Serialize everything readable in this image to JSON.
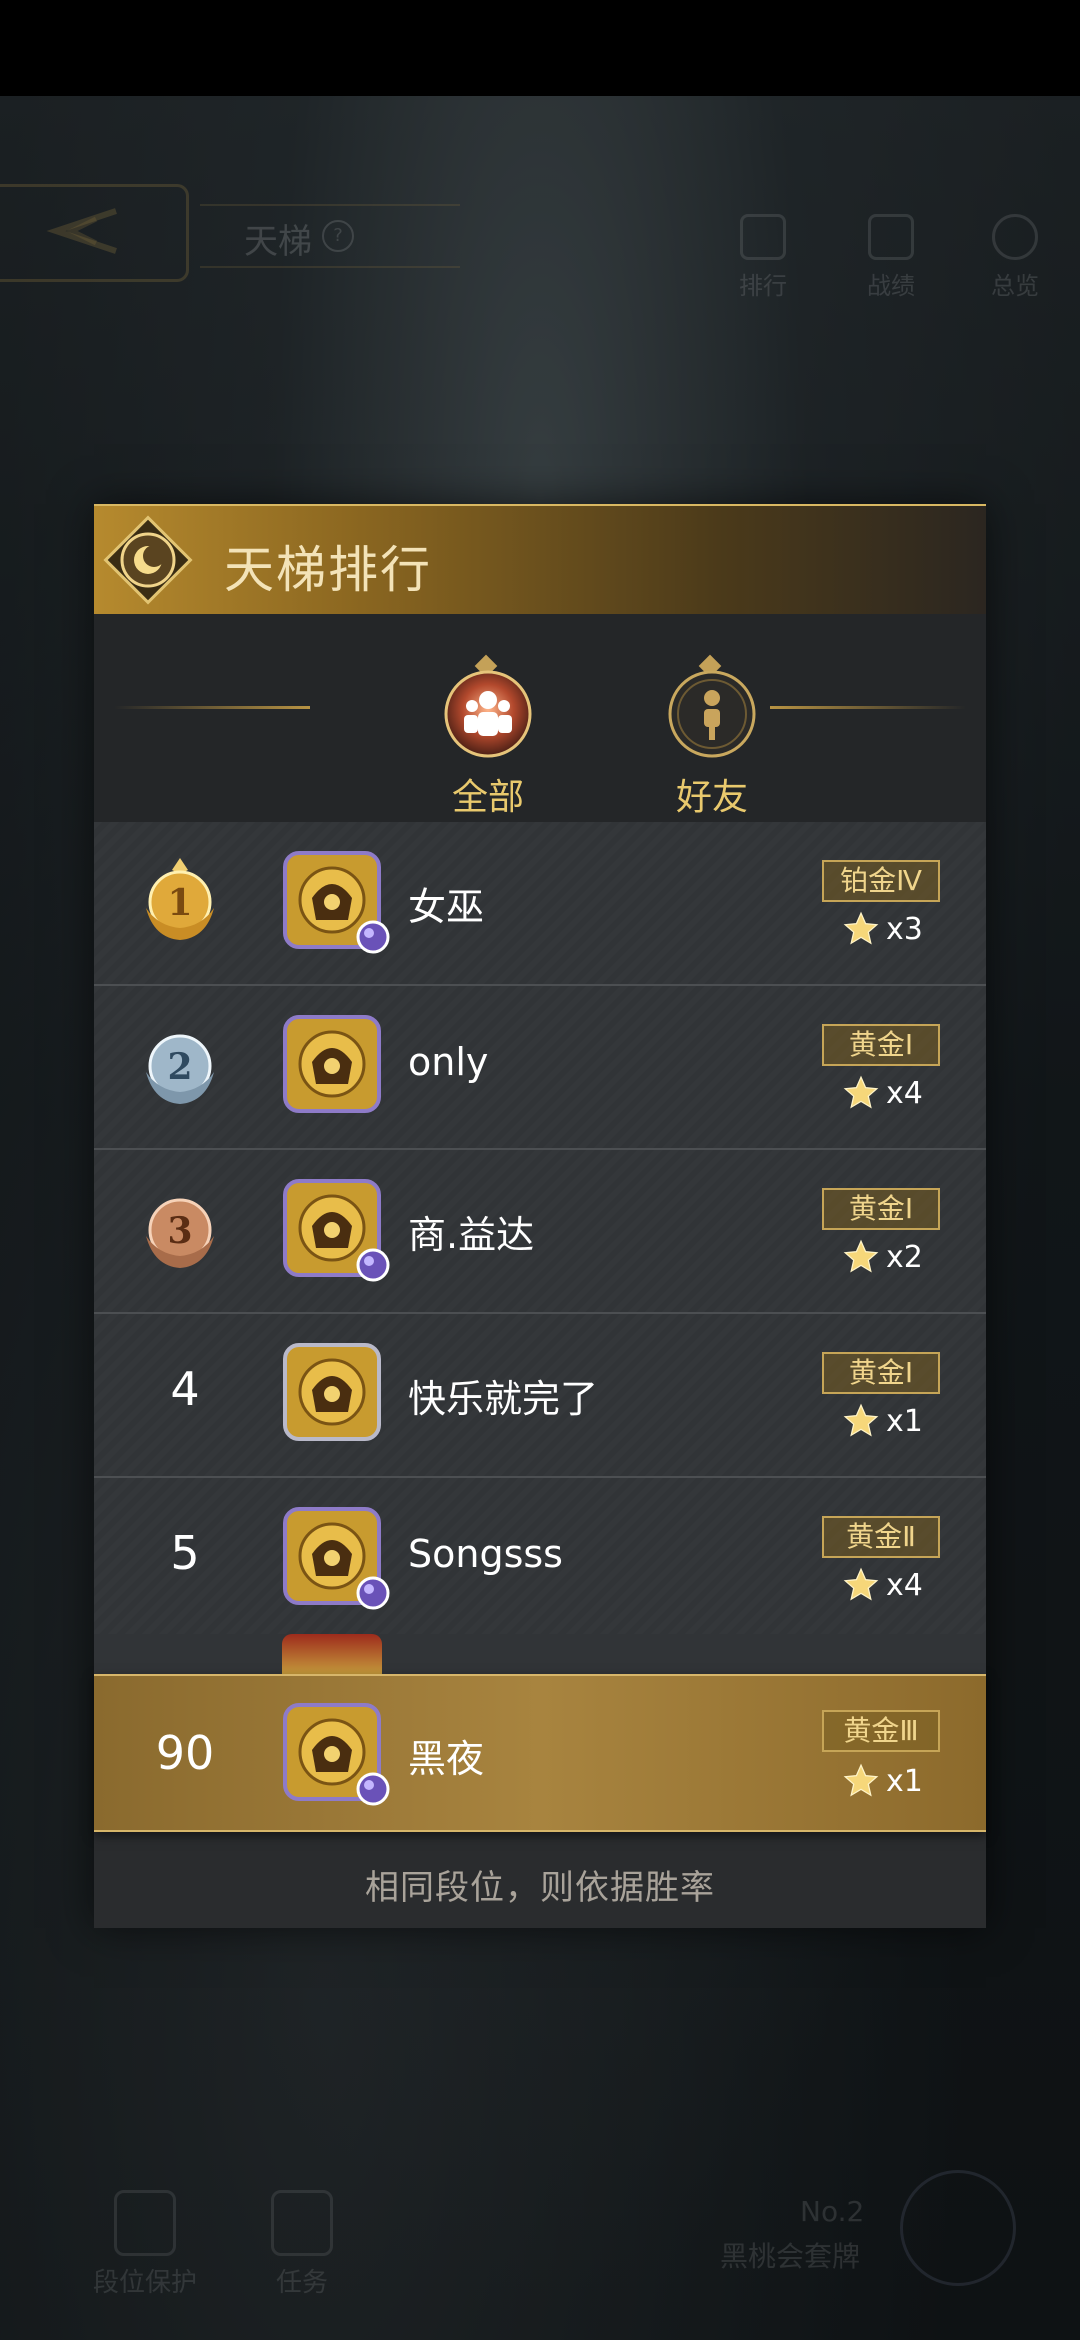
{
  "header": {
    "title": "天梯",
    "help_icon": "question-icon",
    "nav": [
      {
        "label": "排行",
        "icon": "trophy-icon"
      },
      {
        "label": "战绩",
        "icon": "battle-record-icon"
      },
      {
        "label": "总览",
        "icon": "overview-icon"
      }
    ]
  },
  "panel": {
    "title": "天梯排行",
    "tabs": [
      {
        "label": "全部",
        "selected": true,
        "icon": "group-icon"
      },
      {
        "label": "好友",
        "selected": false,
        "icon": "person-icon"
      }
    ],
    "rows": [
      {
        "rank": "1",
        "rank_style": "gold-medal",
        "name": "女巫",
        "tier": "铂金Ⅳ",
        "stars": "x3",
        "has_badge": true
      },
      {
        "rank": "2",
        "rank_style": "silver-medal",
        "name": "only",
        "tier": "黄金Ⅰ",
        "stars": "x4",
        "has_badge": false
      },
      {
        "rank": "3",
        "rank_style": "bronze-medal",
        "name": "商.益达",
        "tier": "黄金Ⅰ",
        "stars": "x2",
        "has_badge": true
      },
      {
        "rank": "4",
        "rank_style": "plain",
        "name": "快乐就完了",
        "tier": "黄金Ⅰ",
        "stars": "x1",
        "has_badge": false
      },
      {
        "rank": "5",
        "rank_style": "plain",
        "name": "Songsss",
        "tier": "黄金Ⅱ",
        "stars": "x4",
        "has_badge": true
      }
    ],
    "self_row": {
      "rank": "90",
      "name": "黑夜",
      "tier": "黄金Ⅲ",
      "stars": "x1",
      "has_badge": true
    },
    "footer_note": "相同段位，则依据胜率"
  },
  "background_bottom": {
    "items": [
      {
        "label": "段位保护",
        "icon": "shield-icon"
      },
      {
        "label": "任务",
        "icon": "task-icon"
      }
    ],
    "suit_no": "No.2",
    "suit_name": "黑桃会套牌"
  },
  "colors": {
    "accent_gold": "#e9c96d",
    "self_row": "#a8843f",
    "panel_bg": "#2a2c2e"
  }
}
